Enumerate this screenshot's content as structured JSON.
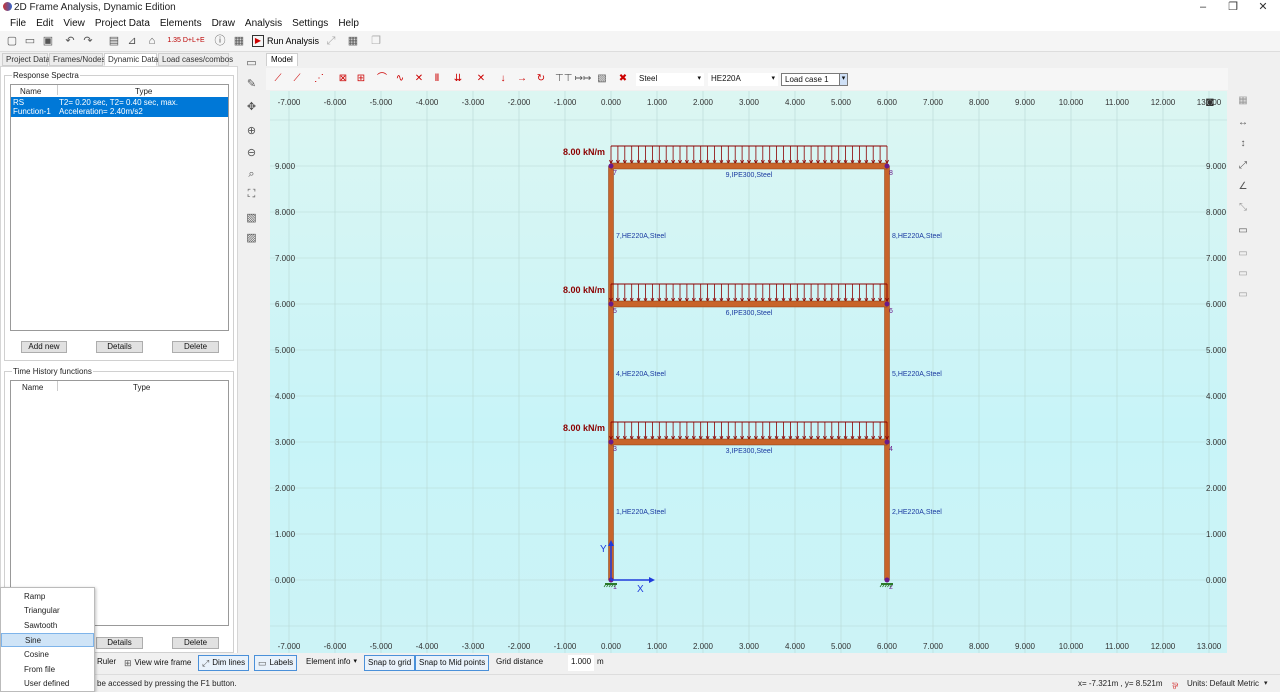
{
  "window": {
    "title": "2D Frame Analysis, Dynamic Edition",
    "min": "–",
    "max": "❐",
    "close": "✕"
  },
  "menu": [
    "File",
    "Edit",
    "View",
    "Project Data",
    "Elements",
    "Draw",
    "Analysis",
    "Settings",
    "Help"
  ],
  "toolbar": {
    "run_label": "Run Analysis"
  },
  "left_tabs": [
    "Project Data",
    "Frames/Nodes",
    "Dynamic Data",
    "Load cases/combos"
  ],
  "response_spectra": {
    "title": "Response Spectra",
    "col_name": "Name",
    "col_type": "Type",
    "rows": [
      {
        "name": "RS Function-1",
        "type": "T2= 0.20 sec, T2= 0.40 sec, max. Acceleration= 2.40m/s2"
      }
    ],
    "btn_add": "Add new",
    "btn_details": "Details",
    "btn_delete": "Delete"
  },
  "time_history": {
    "title": "Time History functions",
    "col_name": "Name",
    "col_type": "Type",
    "btn_details": "Details",
    "btn_delete": "Delete"
  },
  "context_menu": {
    "items": [
      "Ramp",
      "Triangular",
      "Sawtooth",
      "Sine",
      "Cosine",
      "From file",
      "User defined"
    ],
    "selected": "Sine"
  },
  "model_tab": "Model",
  "draw_toolbar": {
    "material": "Steel",
    "section": "HE220A",
    "load_case": "Load case 1"
  },
  "canvas": {
    "x_ticks": [
      "-7.000",
      "-6.000",
      "-5.000",
      "-4.000",
      "-3.000",
      "-2.000",
      "-1.000",
      "0.000",
      "1.000",
      "2.000",
      "3.000",
      "4.000",
      "5.000",
      "6.000",
      "7.000",
      "8.000",
      "9.000",
      "10.000",
      "11.000",
      "12.000",
      "13.000"
    ],
    "y_ticks": [
      "9.000",
      "8.000",
      "7.000",
      "6.000",
      "5.000",
      "4.000",
      "3.000",
      "2.000",
      "1.000",
      "0.000"
    ],
    "loads": [
      {
        "label": "8.00 kN/m",
        "y": 9
      },
      {
        "label": "8.00 kN/m",
        "y": 6
      },
      {
        "label": "8.00 kN/m",
        "y": 3
      }
    ],
    "beams": [
      {
        "label": "9,IPE300,Steel",
        "y": 9
      },
      {
        "label": "6,IPE300,Steel",
        "y": 6
      },
      {
        "label": "3,IPE300,Steel",
        "y": 3
      }
    ],
    "columns": [
      {
        "label": "7,HE220A,Steel",
        "x": 0,
        "ymid": 7.5
      },
      {
        "label": "8,HE220A,Steel",
        "x": 6,
        "ymid": 7.5
      },
      {
        "label": "4,HE220A,Steel",
        "x": 0,
        "ymid": 4.5
      },
      {
        "label": "5,HE220A,Steel",
        "x": 6,
        "ymid": 4.5
      },
      {
        "label": "1,HE220A,Steel",
        "x": 0,
        "ymid": 1.5
      },
      {
        "label": "2,HE220A,Steel",
        "x": 6,
        "ymid": 1.5
      }
    ],
    "nodes": [
      {
        "id": "1",
        "x": 0,
        "y": 0
      },
      {
        "id": "2",
        "x": 6,
        "y": 0
      },
      {
        "id": "3",
        "x": 0,
        "y": 3
      },
      {
        "id": "4",
        "x": 6,
        "y": 3
      },
      {
        "id": "5",
        "x": 0,
        "y": 6
      },
      {
        "id": "6",
        "x": 6,
        "y": 6
      },
      {
        "id": "7",
        "x": 0,
        "y": 9
      },
      {
        "id": "8",
        "x": 6,
        "y": 9
      }
    ],
    "axis_x": "X",
    "axis_y": "Y",
    "colors": {
      "member": "#c8642a",
      "member_edge": "#8a3d12",
      "load": "#8b0000",
      "label": "#1a3aa0",
      "axis": "#1f3bdc",
      "node": "#6a1a8a",
      "grid": "#b7d8d4"
    }
  },
  "bottom_bar": {
    "ruler": "Ruler",
    "wire": "View wire frame",
    "dim": "Dim lines",
    "labels": "Labels",
    "elinfo": "Element info",
    "snap_grid": "Snap to grid",
    "snap_mid": "Snap to Mid points",
    "grid_distance_label": "Grid distance",
    "grid_distance_value": "1.000",
    "grid_distance_unit": "m"
  },
  "status": {
    "help": "be accessed by pressing the F1 button.",
    "coords": "x= -7.321m , y= 8.521m",
    "units": "Units: Default Metric"
  }
}
